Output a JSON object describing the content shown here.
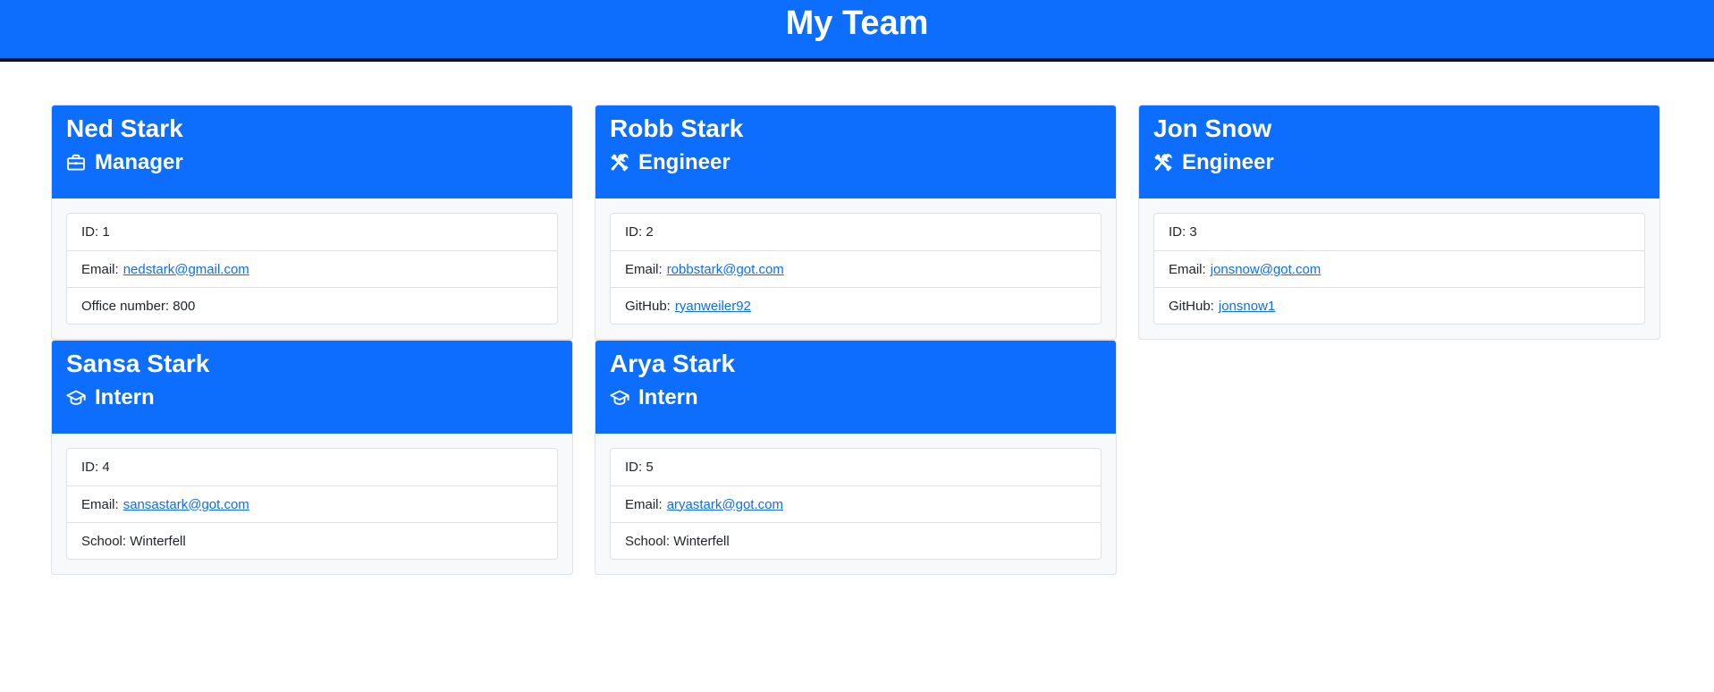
{
  "header": {
    "title": "My Team"
  },
  "team": [
    {
      "name": "Ned Stark",
      "role": "Manager",
      "icon": "briefcase-icon",
      "id_label": "ID: 1",
      "email_label": "Email:",
      "email": "nedstark@gmail.com",
      "extra_label": "Office number: 800",
      "extra_link": ""
    },
    {
      "name": "Robb Stark",
      "role": "Engineer",
      "icon": "tools-icon",
      "id_label": "ID: 2",
      "email_label": "Email:",
      "email": "robbstark@got.com",
      "extra_label": "GitHub:",
      "extra_link": "ryanweiler92"
    },
    {
      "name": "Jon Snow",
      "role": "Engineer",
      "icon": "tools-icon",
      "id_label": "ID: 3",
      "email_label": "Email:",
      "email": "jonsnow@got.com",
      "extra_label": "GitHub:",
      "extra_link": "jonsnow1"
    },
    {
      "name": "Sansa Stark",
      "role": "Intern",
      "icon": "graduation-cap-icon",
      "id_label": "ID: 4",
      "email_label": "Email:",
      "email": "sansastark@got.com",
      "extra_label": "School: Winterfell",
      "extra_link": ""
    },
    {
      "name": "Arya Stark",
      "role": "Intern",
      "icon": "graduation-cap-icon",
      "id_label": "ID: 5",
      "email_label": "Email:",
      "email": "aryastark@got.com",
      "extra_label": "School: Winterfell",
      "extra_link": ""
    }
  ],
  "colors": {
    "primary": "#0d6efd",
    "link": "#0d6efd",
    "card_bg": "#f8f9fa"
  }
}
